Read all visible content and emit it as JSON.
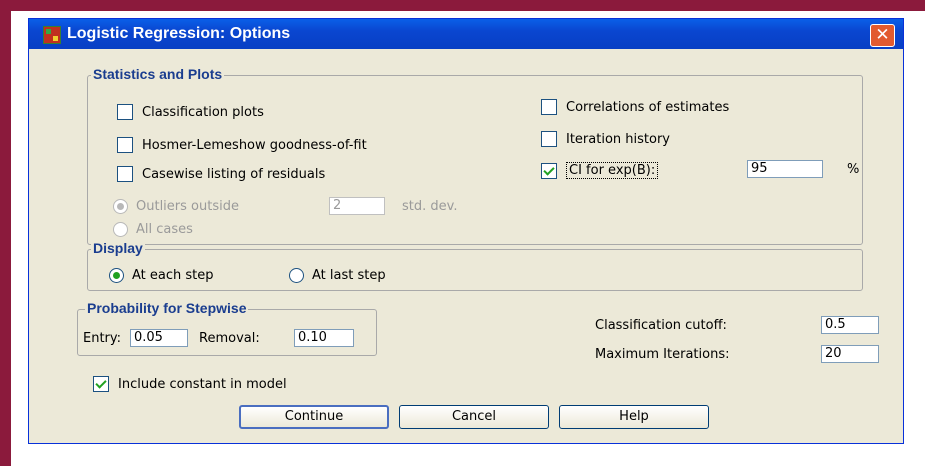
{
  "dialog": {
    "title": "Logistic Regression: Options",
    "close_label": "✕"
  },
  "statistics": {
    "group_label": "Statistics and Plots",
    "classification_plots": {
      "label": "Classification plots",
      "checked": false
    },
    "hosmer_lemeshow": {
      "label": "Hosmer-Lemeshow goodness-of-fit",
      "checked": false
    },
    "casewise_listing": {
      "label": "Casewise listing of residuals",
      "checked": false
    },
    "outliers_outside": {
      "label": "Outliers outside",
      "value": "2",
      "unit": "std. dev.",
      "selected": true,
      "enabled": false
    },
    "all_cases": {
      "label": "All cases",
      "selected": false,
      "enabled": false
    },
    "correlations": {
      "label": "Correlations of estimates",
      "checked": false
    },
    "iteration_history": {
      "label": "Iteration history",
      "checked": false
    },
    "ci_exp_b": {
      "label": "CI for exp(B):",
      "checked": true,
      "value": "95",
      "unit": "%"
    }
  },
  "display": {
    "group_label": "Display",
    "each_step": {
      "label": "At each step",
      "selected": true
    },
    "last_step": {
      "label": "At last step",
      "selected": false
    }
  },
  "stepwise": {
    "group_label": "Probability for Stepwise",
    "entry_label": "Entry:",
    "entry_value": "0.05",
    "removal_label": "Removal:",
    "removal_value": "0.10"
  },
  "cutoff": {
    "label": "Classification cutoff:",
    "value": "0.5"
  },
  "max_iterations": {
    "label": "Maximum Iterations:",
    "value": "20"
  },
  "include_constant": {
    "label": "Include constant in model",
    "checked": true
  },
  "buttons": {
    "continue": "Continue",
    "cancel": "Cancel",
    "help": "Help"
  }
}
